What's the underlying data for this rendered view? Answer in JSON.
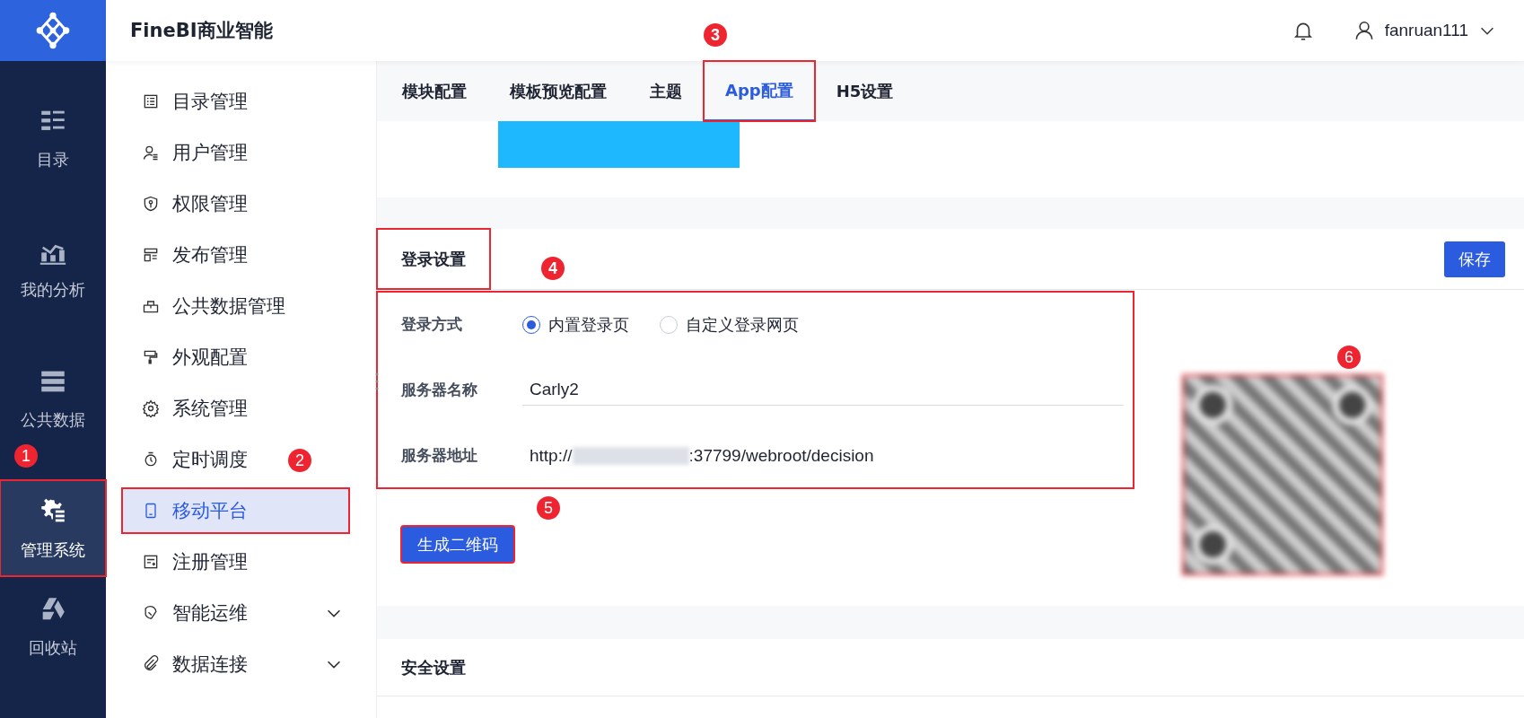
{
  "app": {
    "title": "FineBI商业智能",
    "user": "fanruan111"
  },
  "rail": [
    {
      "label": "目录",
      "selected": false
    },
    {
      "label": "我的分析",
      "selected": false
    },
    {
      "label": "公共数据",
      "selected": false
    },
    {
      "label": "管理系统",
      "selected": true,
      "badge": "1"
    },
    {
      "label": "回收站",
      "selected": false
    }
  ],
  "menu": [
    {
      "label": "目录管理",
      "selected": false
    },
    {
      "label": "用户管理",
      "selected": false
    },
    {
      "label": "权限管理",
      "selected": false
    },
    {
      "label": "发布管理",
      "selected": false
    },
    {
      "label": "公共数据管理",
      "selected": false
    },
    {
      "label": "外观配置",
      "selected": false
    },
    {
      "label": "系统管理",
      "selected": false
    },
    {
      "label": "定时调度",
      "selected": false,
      "badge": "2"
    },
    {
      "label": "移动平台",
      "selected": true
    },
    {
      "label": "注册管理",
      "selected": false
    },
    {
      "label": "智能运维",
      "selected": false,
      "expanded": false
    },
    {
      "label": "数据连接",
      "selected": false,
      "expanded": false
    }
  ],
  "tabs": [
    {
      "label": "模块配置",
      "selected": false
    },
    {
      "label": "模板预览配置",
      "selected": false
    },
    {
      "label": "主题",
      "selected": false
    },
    {
      "label": "App配置",
      "selected": true,
      "badge": "3"
    },
    {
      "label": "H5设置",
      "selected": false
    }
  ],
  "login_section": {
    "title": "登录设置",
    "badge": "4",
    "save_button": "保存",
    "login_mode": {
      "label": "登录方式",
      "options": [
        {
          "label": "内置登录页",
          "selected": true
        },
        {
          "label": "自定义登录网页",
          "selected": false
        }
      ]
    },
    "server_name": {
      "label": "服务器名称",
      "value": "Carly2"
    },
    "server_address": {
      "label": "服务器地址",
      "value_start": "http://",
      "value_end": ":37799/webroot/decision"
    },
    "generate_button": {
      "label": "生成二维码",
      "badge": "5"
    },
    "qr_badge": "6"
  },
  "security_section": {
    "title": "安全设置"
  }
}
